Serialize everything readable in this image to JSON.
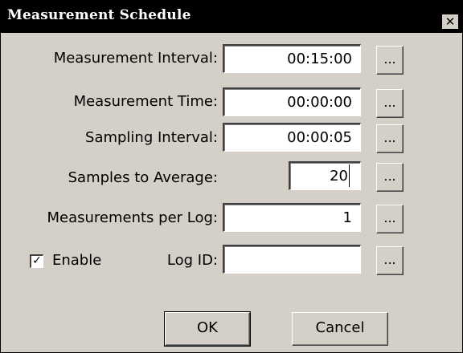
{
  "window": {
    "title": "Measurement Schedule",
    "close_label": "✕"
  },
  "form": {
    "measurement_interval": {
      "label": "Measurement Interval:",
      "value": "00:15:00"
    },
    "measurement_time": {
      "label": "Measurement Time:",
      "value": "00:00:00"
    },
    "sampling_interval": {
      "label": "Sampling Interval:",
      "value": "00:00:05"
    },
    "samples_to_average": {
      "label": "Samples to Average:",
      "value": "20"
    },
    "measurements_per_log": {
      "label": "Measurements per Log:",
      "value": "1"
    },
    "enable": {
      "label": "Enable",
      "checked": true,
      "check_glyph": "✓"
    },
    "log_id": {
      "label": "Log ID:",
      "value": ""
    },
    "browse_label": "..."
  },
  "buttons": {
    "ok_label": "OK",
    "cancel_label": "Cancel"
  }
}
